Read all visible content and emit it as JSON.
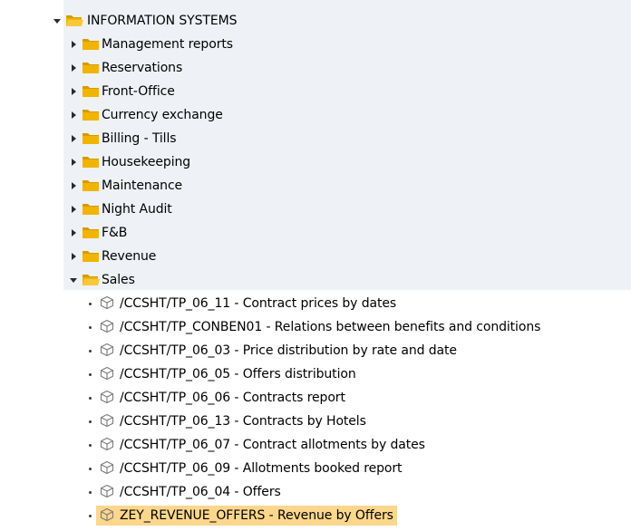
{
  "tree": {
    "root": {
      "label": "INFORMATION SYSTEMS",
      "expanded": true
    },
    "folders": [
      {
        "label": "Management reports",
        "expanded": false
      },
      {
        "label": "Reservations",
        "expanded": false
      },
      {
        "label": "Front-Office",
        "expanded": false
      },
      {
        "label": "Currency exchange",
        "expanded": false
      },
      {
        "label": "Billing - Tills",
        "expanded": false
      },
      {
        "label": "Housekeeping",
        "expanded": false
      },
      {
        "label": "Maintenance",
        "expanded": false
      },
      {
        "label": "Night Audit",
        "expanded": false
      },
      {
        "label": "F&B",
        "expanded": false
      },
      {
        "label": "Revenue",
        "expanded": false
      },
      {
        "label": "Sales",
        "expanded": true
      }
    ],
    "sales_items": [
      {
        "label": "/CCSHT/TP_06_11 - Contract prices by dates",
        "selected": false
      },
      {
        "label": "/CCSHT/TP_CONBEN01 - Relations between benefits and conditions",
        "selected": false
      },
      {
        "label": "/CCSHT/TP_06_03 - Price distribution by rate and date",
        "selected": false
      },
      {
        "label": "/CCSHT/TP_06_05 - Offers distribution",
        "selected": false
      },
      {
        "label": "/CCSHT/TP_06_06 - Contracts report",
        "selected": false
      },
      {
        "label": "/CCSHT/TP_06_13 - Contracts by Hotels",
        "selected": false
      },
      {
        "label": "/CCSHT/TP_06_07 - Contract allotments by dates",
        "selected": false
      },
      {
        "label": "/CCSHT/TP_06_09 - Allotments booked report",
        "selected": false
      },
      {
        "label": "/CCSHT/TP_06_04 - Offers",
        "selected": false
      },
      {
        "label": "ZEY_REVENUE_OFFERS - Revenue by Offers",
        "selected": true
      }
    ],
    "colors": {
      "folder": "#f1b400",
      "folder_dark": "#d79a00",
      "selection": "#fbd68d",
      "panel_bg": "#eef2f6"
    },
    "icons": {
      "folder_closed": "folder-icon",
      "folder_open": "folder-open-icon",
      "transaction": "cube-icon"
    }
  }
}
